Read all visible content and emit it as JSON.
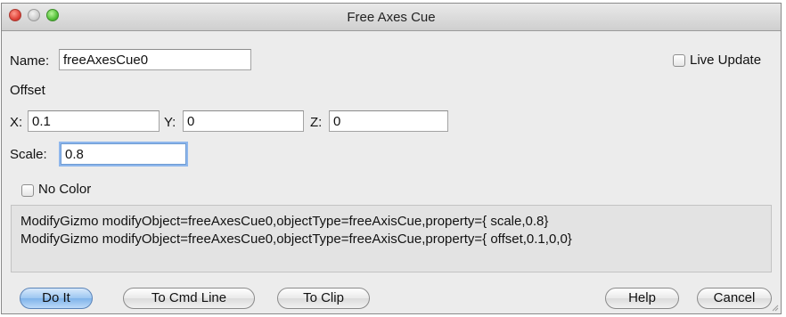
{
  "window": {
    "title": "Free Axes Cue"
  },
  "name_row": {
    "label": "Name:",
    "value": "freeAxesCue0"
  },
  "live_update": {
    "label": "Live Update",
    "checked": false
  },
  "offset": {
    "heading": "Offset",
    "x_label": "X:",
    "x_value": "0.1",
    "y_label": "Y:",
    "y_value": "0",
    "z_label": "Z:",
    "z_value": "0"
  },
  "scale": {
    "label": "Scale:",
    "value": "0.8"
  },
  "no_color": {
    "label": "No Color",
    "checked": false
  },
  "command_output": {
    "lines": [
      "ModifyGizmo modifyObject=freeAxesCue0,objectType=freeAxisCue,property={ scale,0.8}",
      "ModifyGizmo modifyObject=freeAxesCue0,objectType=freeAxisCue,property={ offset,0.1,0,0}"
    ]
  },
  "buttons": {
    "do_it": "Do It",
    "to_cmd_line": "To Cmd Line",
    "to_clip": "To Clip",
    "help": "Help",
    "cancel": "Cancel"
  },
  "colors": {
    "close": "#e0443a",
    "minimize": "#cfcfcf",
    "zoom": "#55c13a",
    "default_button": "#9cc6f1"
  }
}
